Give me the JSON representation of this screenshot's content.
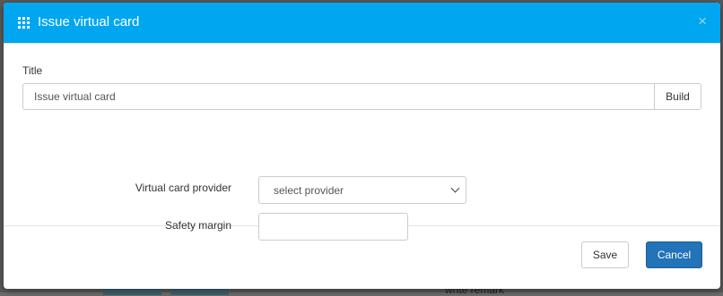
{
  "modal": {
    "title": "Issue virtual card",
    "close_glyph": "×",
    "header_color": "#00a7f0"
  },
  "form": {
    "title_label": "Title",
    "title_value": "Issue virtual card",
    "build_label": "Build",
    "provider_label": "Virtual card provider",
    "provider_selected": "select provider",
    "margin_label": "Safety margin",
    "margin_value": ""
  },
  "footer": {
    "save_label": "Save",
    "cancel_label": "Cancel",
    "cancel_color": "#2273b7"
  },
  "background": {
    "partial_text": "write remark"
  },
  "icons": {
    "header": "grid-icon",
    "close": "close-icon",
    "select": "chevron-down-icon"
  }
}
